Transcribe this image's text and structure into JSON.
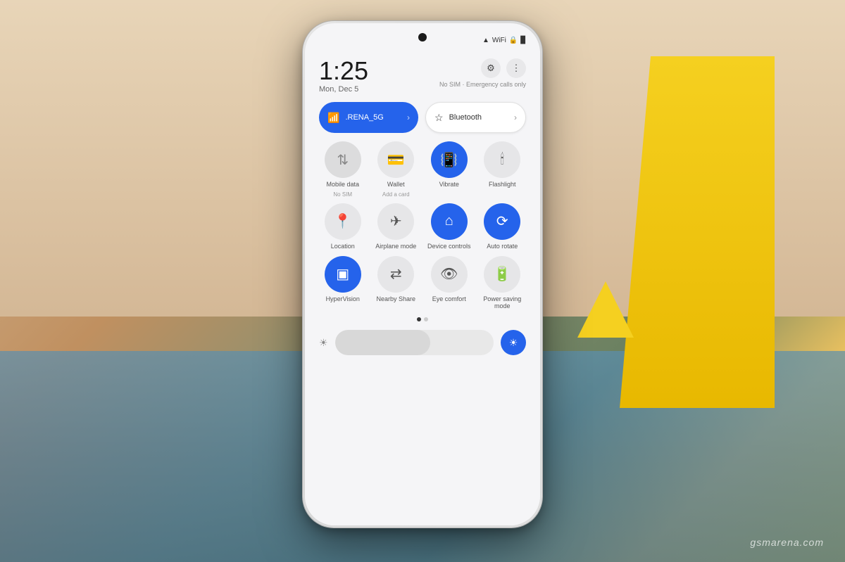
{
  "background": {
    "beige": "#d4b896",
    "blue": "#4a7a9b",
    "yellow": "#f5d020"
  },
  "watermark": {
    "text": "gsmarena.com"
  },
  "phone": {
    "status_bar": {
      "icons": [
        "signal",
        "wifi",
        "lock",
        "battery"
      ],
      "battery_text": "■"
    },
    "time": {
      "display": "1:25",
      "date": "Mon, Dec 5"
    },
    "header_buttons": {
      "settings_icon": "⚙",
      "more_icon": "⋮"
    },
    "sim_text": "No SIM · Emergency calls only",
    "wifi_tile": {
      "icon": "📶",
      "label": ".RENA_5G",
      "arrow": "›"
    },
    "bluetooth_tile": {
      "icon": "✦",
      "label": "Bluetooth",
      "arrow": "›"
    },
    "toggles": [
      {
        "icon": "↕",
        "label": "Mobile data",
        "sublabel": "No SIM",
        "state": "gray"
      },
      {
        "icon": "💳",
        "label": "Wallet",
        "sublabel": "Add a card",
        "state": "inactive"
      },
      {
        "icon": "📳",
        "label": "Vibrate",
        "sublabel": "",
        "state": "active"
      },
      {
        "icon": "🔦",
        "label": "Flashlight",
        "sublabel": "",
        "state": "inactive"
      },
      {
        "icon": "📍",
        "label": "Location",
        "sublabel": "",
        "state": "inactive"
      },
      {
        "icon": "✈",
        "label": "Airplane mode",
        "sublabel": "",
        "state": "inactive"
      },
      {
        "icon": "⌂",
        "label": "Device controls",
        "sublabel": "",
        "state": "active"
      },
      {
        "icon": "🔄",
        "label": "Auto rotate",
        "sublabel": "",
        "state": "active"
      },
      {
        "icon": "👁",
        "label": "HyperVision",
        "sublabel": "",
        "state": "active"
      },
      {
        "icon": "~",
        "label": "Nearby Share",
        "sublabel": "",
        "state": "inactive"
      },
      {
        "icon": "👁",
        "label": "Eye comfort",
        "sublabel": "",
        "state": "inactive"
      },
      {
        "icon": "🔋",
        "label": "Power saving mode",
        "sublabel": "",
        "state": "inactive"
      }
    ],
    "dots": {
      "active_index": 0,
      "count": 2
    },
    "brightness": {
      "min_icon": "☀",
      "max_icon": "☀",
      "fill_percent": 60
    }
  }
}
